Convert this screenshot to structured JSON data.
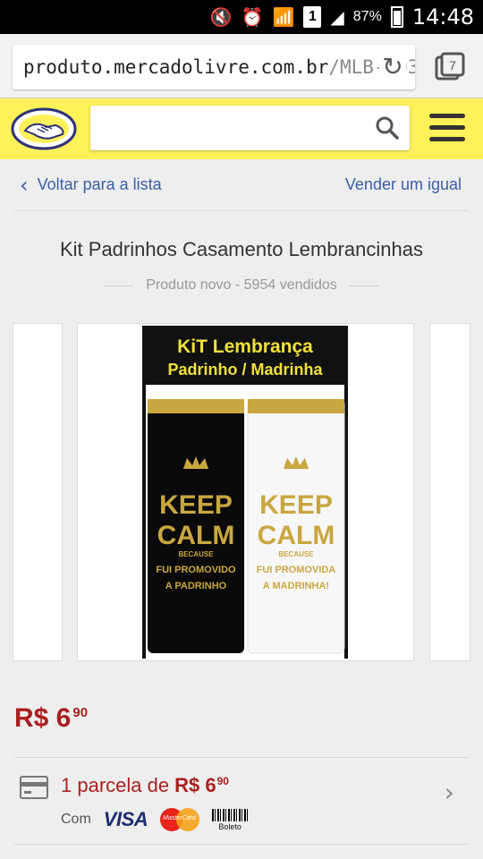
{
  "status_bar": {
    "battery_percent": "87%",
    "time": "14:48",
    "sim_slot": "1",
    "icons": [
      "mute-icon",
      "alarm-icon",
      "wifi-icon",
      "sim-icon",
      "signal-icon",
      "battery-icon"
    ]
  },
  "browser": {
    "url_host": "produto.mercadolivre.com.br",
    "url_path": "/MLB-693",
    "tab_count": "7"
  },
  "header": {
    "brand_color": "#fff159",
    "search_placeholder": ""
  },
  "nav": {
    "back_label": "Voltar para a lista",
    "sell_label": "Vender um igual"
  },
  "product": {
    "title": "Kit Padrinhos Casamento Lembrancinhas",
    "subtitle": "Produto novo - 5954 vendidos",
    "image": {
      "banner_line1": "KiT Lembrança",
      "banner_line2": "Padrinho / Madrinha",
      "left_cup_text": [
        "KEEP",
        "CALM",
        "BECAUSE",
        "FUI PROMOVIDO",
        "A PADRINHO"
      ],
      "right_cup_text": [
        "KEEP",
        "CALM",
        "BECAUSE",
        "FUI PROMOVIDA",
        "A MADRINHA!"
      ]
    },
    "price": {
      "currency_amount": "R$ 6",
      "cents": "90",
      "color": "#a82020"
    }
  },
  "payment": {
    "installments_text": "1 parcela de",
    "installments_amount": "R$ 6",
    "installments_cents": "90",
    "com_label": "Com",
    "methods": [
      "VISA",
      "MasterCard",
      "Boleto"
    ]
  }
}
